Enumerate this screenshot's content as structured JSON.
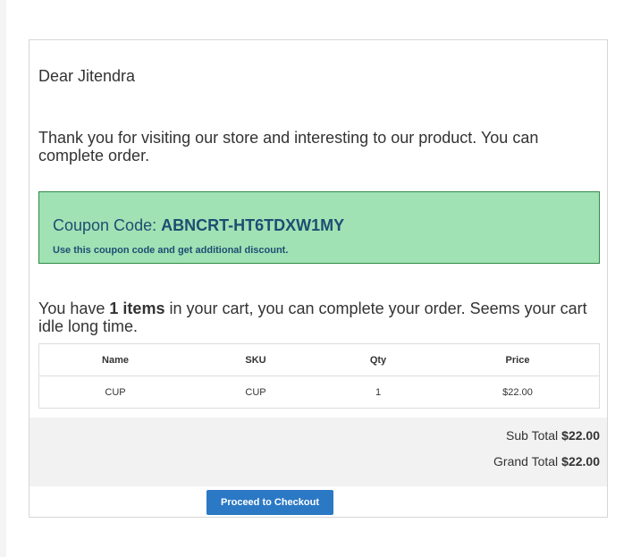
{
  "email": {
    "greeting": "Dear Jitendra",
    "intro": "Thank you for visiting our store and interesting to our product. You can complete order.",
    "coupon": {
      "label": "Coupon Code:",
      "code": "ABNCRT-HT6TDXW1MY",
      "note": "Use this coupon code and get additional discount."
    },
    "cart_message": {
      "before": "You have ",
      "count": "1 items",
      "after": " in your cart, you can complete your order. Seems your cart idle long time."
    },
    "table": {
      "headers": [
        "Name",
        "SKU",
        "Qty",
        "Price"
      ],
      "rows": [
        [
          "CUP",
          "CUP",
          "1",
          "$22.00"
        ]
      ]
    },
    "totals": {
      "subtotal_label": "Sub Total",
      "subtotal_value": "$22.00",
      "grandtotal_label": "Grand Total",
      "grandtotal_value": "$22.00"
    },
    "checkout_label": "Proceed to Checkout",
    "colors": {
      "coupon_bg": "#a0e2b4",
      "coupon_border": "#2f8a45",
      "coupon_text": "#1e4d72",
      "button_bg": "#2b78c5"
    }
  }
}
